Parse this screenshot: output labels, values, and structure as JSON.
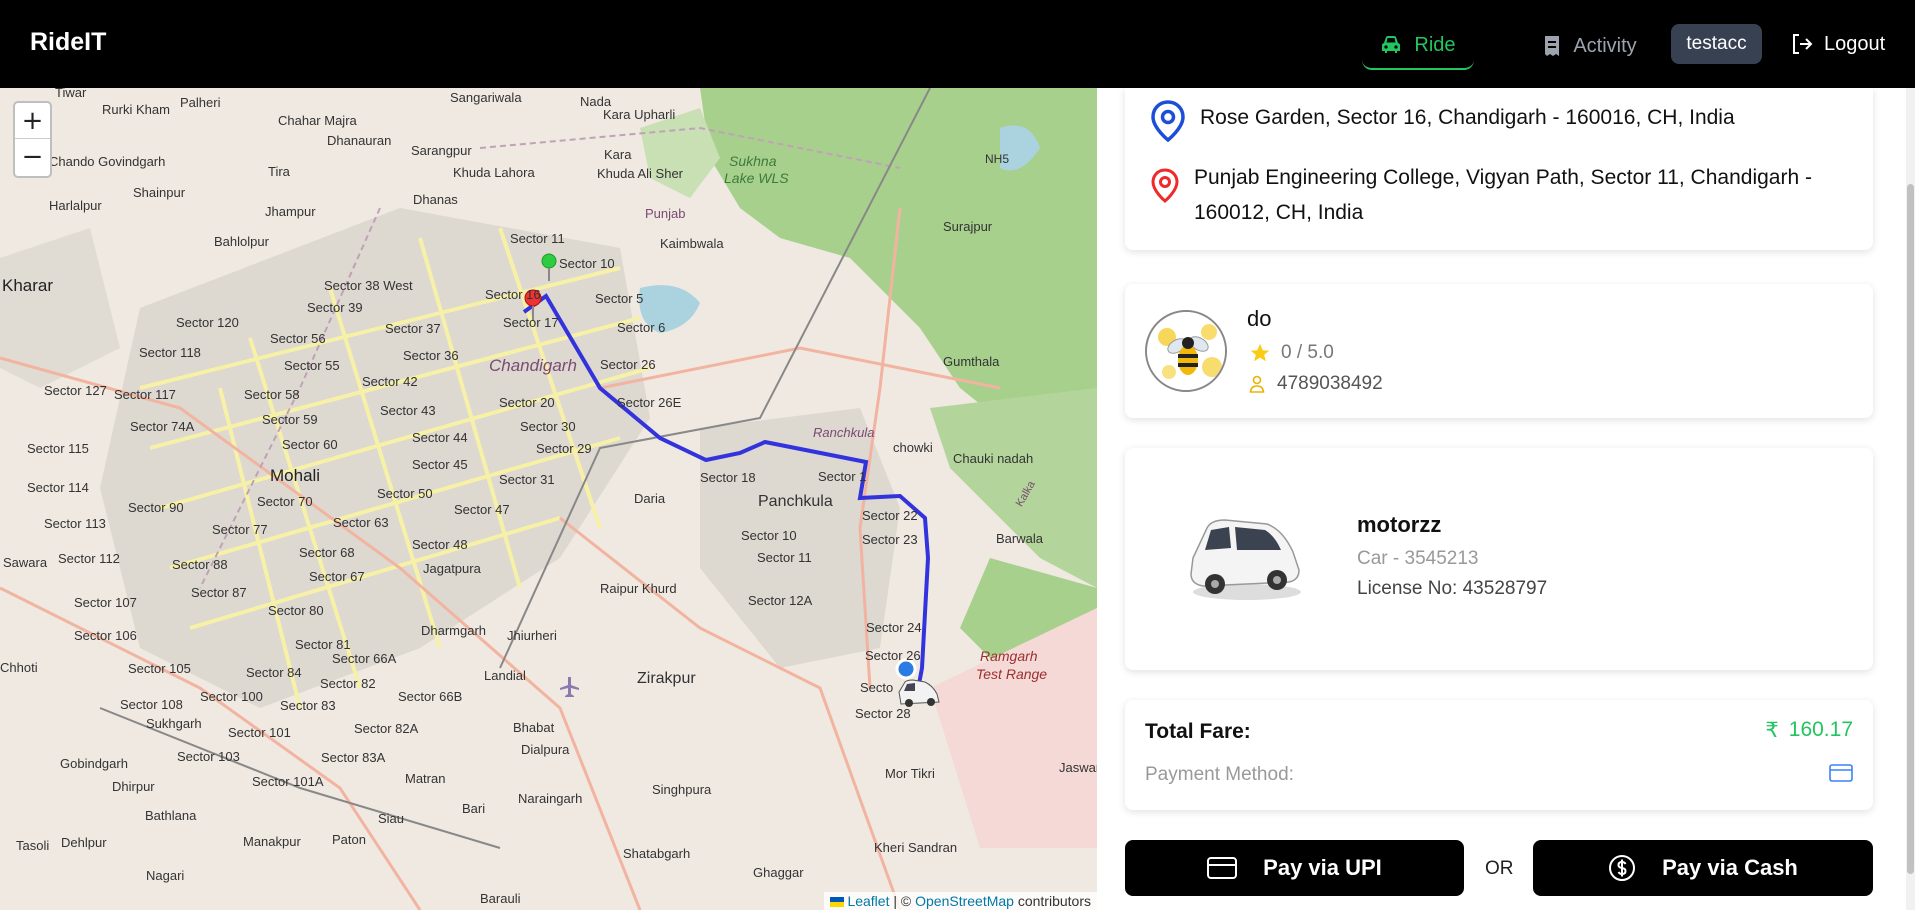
{
  "header": {
    "brand": "RideIT",
    "nav": {
      "ride": "Ride",
      "activity": "Activity",
      "user": "testacc",
      "logout": "Logout"
    },
    "colors": {
      "active": "#22c55e",
      "inactive": "#9ca3af"
    }
  },
  "map": {
    "zoom_in": "+",
    "zoom_out": "−",
    "attribution": {
      "leaflet": "Leaflet",
      "sep": " | © ",
      "osm": "OpenStreetMap",
      "contributors": " contributors"
    },
    "labels": {
      "tiwar": "Tiwar",
      "palheri": "Palheri",
      "sangariwala": "Sangariwala",
      "nada": "Nada",
      "karaupharli": "Kara Upharli",
      "rurkikham": "Rurki Kham",
      "chaharmajra": "Chahar Majra",
      "dhanauran": "Dhanauran",
      "sarangpur": "Sarangpur",
      "chandogovindgarh": "Chando Govindgarh",
      "tira": "Tira",
      "khudalahora": "Khuda Lahora",
      "khudaalisher": "Khuda Ali Sher",
      "kara": "Kara",
      "sukhna": "Sukhna",
      "sukhnalake": "Lake WLS",
      "nh5": "NH5",
      "shainpur": "Shainpur",
      "harlalpur": "Harlalpur",
      "dhanas": "Dhanas",
      "jhampur": "Jhampur",
      "punjab": "Punjab",
      "surajpur": "Surajpur",
      "bahlolpur": "Bahlolpur",
      "sector11": "Sector 11",
      "sector10": "Sector 10",
      "kaimbwala": "Kaimbwala",
      "kharar": "Kharar",
      "sector38w": "Sector 38 West",
      "sector16": "Sector 16",
      "sector5": "Sector 5",
      "sector39": "Sector 39",
      "sector120": "Sector 120",
      "sector17": "Sector 17",
      "sector6": "Sector 6",
      "sector56": "Sector 56",
      "sector37": "Sector 37",
      "sector118": "Sector 118",
      "sector36": "Sector 36",
      "chandigarh": "Chandigarh",
      "sector26": "Sector 26",
      "gumthala": "Gumthala",
      "sector55": "Sector 55",
      "sector42": "Sector 42",
      "sector127": "Sector 127",
      "sector117": "Sector 117",
      "sector58": "Sector 58",
      "sector20": "Sector 20",
      "sector26e": "Sector 26E",
      "sector43": "Sector 43",
      "sector74a": "Sector 74A",
      "sector59": "Sector 59",
      "sector30": "Sector 30",
      "panchkula_it": "Panchkula",
      "sector44": "Sector 44",
      "sector115": "Sector 115",
      "sector60": "Sector 60",
      "sector29": "Sector 29",
      "chowki": "chowki",
      "mohali": "Mohali",
      "sector45": "Sector 45",
      "chaukinadah": "Chauki nadah",
      "sector114": "Sector 114",
      "sector18": "Sector 18",
      "sector1": "Sector 1",
      "sector31": "Sector 31",
      "sector90": "Sector 90",
      "sector70": "Sector 70",
      "sector50": "Sector 50",
      "sector47": "Sector 47",
      "daria": "Daria",
      "panchkula": "Panchkula",
      "sector113": "Sector 113",
      "sector22": "Sector 22",
      "sector77": "Sector 77",
      "sector63": "Sector 63",
      "sector10b": "Sector 10",
      "sector23": "Sector 23",
      "barwala": "Barwala",
      "sector48": "Sector 48",
      "sector112": "Sector 112",
      "sector68": "Sector 68",
      "sector11b": "Sector 11",
      "sawara": "Sawara",
      "sector88": "Sector 88",
      "jagatpura": "Jagatpura",
      "sector67": "Sector 67",
      "sector87": "Sector 87",
      "raipurkhurd": "Raipur Khurd",
      "sector12a": "Sector 12A",
      "sector107": "Sector 107",
      "sector80": "Sector 80",
      "sector106": "Sector 106",
      "dharmgarh": "Dharmgarh",
      "jhiurheri": "Jhiurheri",
      "sector24": "Sector 24",
      "sector81": "Sector 81",
      "sector26b": "Sector 26",
      "ramgarh": "Ramgarh",
      "testrange": "Test Range",
      "chhoti": "Chhoti",
      "sector105": "Sector 105",
      "sector66a": "Sector 66A",
      "sector84": "Sector 84",
      "landial": "Landial",
      "zirakpur": "Zirakpur",
      "sector82": "Sector 82",
      "sector100": "Sector 100",
      "sector108": "Sector 108",
      "sector83": "Sector 83",
      "sector66b": "Sector 66B",
      "sector27": "Secto",
      "sector28": "Sector 28",
      "sukhgarh": "Sukhgarh",
      "sector101": "Sector 101",
      "sector82a": "Sector 82A",
      "bhabat": "Bhabat",
      "sector103": "Sector 103",
      "dialpura": "Dialpura",
      "gobindgarh": "Gobindgarh",
      "sector83a": "Sector 83A",
      "jaswan": "Jaswan",
      "motikri": "Mor Tikri",
      "dhirpur": "Dhirpur",
      "sector101a": "Sector 101A",
      "matran": "Matran",
      "narayangarh": "Naraingarh",
      "singhpura": "Singhpura",
      "bathlana": "Bathlana",
      "siau": "Siau",
      "bari": "Bari",
      "tasoli": "Tasoli",
      "dehlpur": "Dehlpur",
      "manakpur": "Manakpur",
      "paton": "Paton",
      "kherisandran": "Kheri Sandran",
      "shatabgarh": "Shatabgarh",
      "nagari": "Nagari",
      "ghaggar": "Ghaggar",
      "barauli": "Barauli",
      "ranchkula": "Ranchkula",
      "kalka": "Kalka"
    }
  },
  "trip": {
    "pickup": "Rose Garden, Sector 16, Chandigarh - 160016, CH, India",
    "dropoff_line1": "Punjab Engineering College, Vigyan Path, Sector 11, Chandigarh -",
    "dropoff_line2": "160012, CH, India"
  },
  "driver": {
    "name": "do",
    "rating": "0 / 5.0",
    "phone": "4789038492"
  },
  "vehicle": {
    "name": "motorzz",
    "model": "Car - 3545213",
    "license": "License No: 43528797"
  },
  "fare": {
    "label": "Total Fare:",
    "currency": "₹",
    "amount": "160.17",
    "payment_label": "Payment Method:"
  },
  "actions": {
    "upi": "Pay via UPI",
    "or": "OR",
    "cash": "Pay via Cash"
  }
}
